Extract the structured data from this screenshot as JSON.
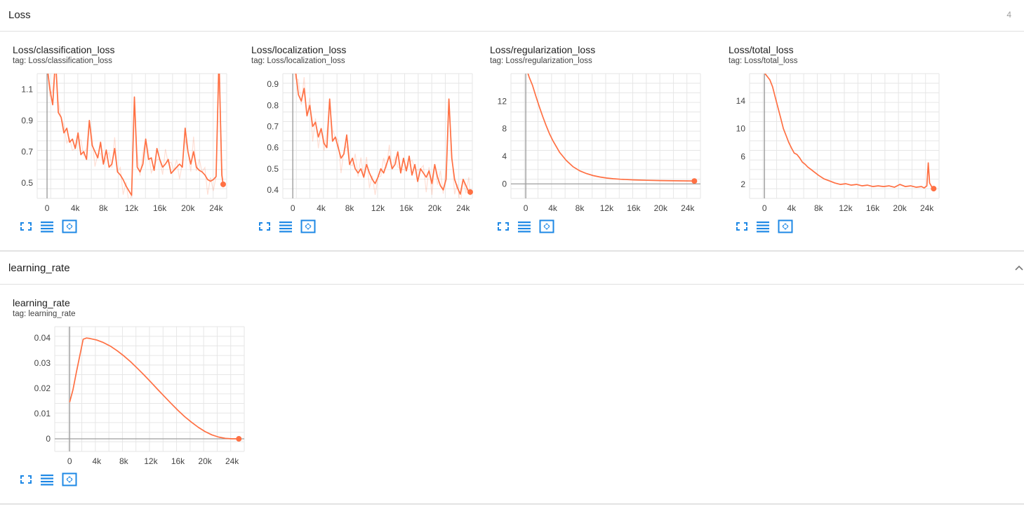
{
  "sections": [
    {
      "title": "Loss",
      "count": "4",
      "charts": [
        {
          "title": "Loss/classification_loss",
          "tag": "tag: Loss/classification_loss",
          "chart_data": {
            "type": "line",
            "x_ticks": [
              "0",
              "4k",
              "8k",
              "12k",
              "16k",
              "20k",
              "24k"
            ],
            "y_ticks": [
              "0.5",
              "0.7",
              "0.9",
              "1.1"
            ],
            "xlim": [
              -1400,
              25500
            ],
            "ylim": [
              0.4,
              1.2
            ],
            "series": [
              {
                "x": [
                  0,
                  400,
                  800,
                  1200,
                  1600,
                  2000,
                  2400,
                  2800,
                  3200,
                  3600,
                  4000,
                  4400,
                  4800,
                  5200,
                  5600,
                  6000,
                  6400,
                  6800,
                  7200,
                  7600,
                  8000,
                  8400,
                  8800,
                  9200,
                  9600,
                  10000,
                  10400,
                  10800,
                  11200,
                  11600,
                  12000,
                  12400,
                  12800,
                  13200,
                  13600,
                  14000,
                  14400,
                  14800,
                  15200,
                  15600,
                  16000,
                  16400,
                  16800,
                  17200,
                  17600,
                  18000,
                  18400,
                  18800,
                  19200,
                  19600,
                  20000,
                  20400,
                  20800,
                  21200,
                  21600,
                  22000,
                  22400,
                  22800,
                  23200,
                  23600,
                  24000,
                  24400,
                  24800,
                  25000
                ],
                "y": [
                  1.25,
                  1.1,
                  1.0,
                  1.3,
                  0.95,
                  0.92,
                  0.82,
                  0.85,
                  0.76,
                  0.78,
                  0.72,
                  0.82,
                  0.68,
                  0.7,
                  0.65,
                  0.9,
                  0.74,
                  0.7,
                  0.66,
                  0.76,
                  0.62,
                  0.71,
                  0.6,
                  0.62,
                  0.72,
                  0.57,
                  0.55,
                  0.52,
                  0.48,
                  0.45,
                  0.42,
                  1.05,
                  0.6,
                  0.57,
                  0.62,
                  0.78,
                  0.65,
                  0.66,
                  0.58,
                  0.72,
                  0.65,
                  0.6,
                  0.62,
                  0.65,
                  0.56,
                  0.58,
                  0.6,
                  0.62,
                  0.6,
                  0.85,
                  0.7,
                  0.62,
                  0.7,
                  0.6,
                  0.58,
                  0.57,
                  0.55,
                  0.52,
                  0.51,
                  0.52,
                  0.54,
                  1.3,
                  0.55,
                  0.49
                ]
              }
            ]
          }
        },
        {
          "title": "Loss/localization_loss",
          "tag": "tag: Loss/localization_loss",
          "chart_data": {
            "type": "line",
            "x_ticks": [
              "0",
              "4k",
              "8k",
              "12k",
              "16k",
              "20k",
              "24k"
            ],
            "y_ticks": [
              "0.4",
              "0.5",
              "0.6",
              "0.7",
              "0.8",
              "0.9"
            ],
            "xlim": [
              -1400,
              25300
            ],
            "ylim": [
              0.36,
              0.95
            ],
            "series": [
              {
                "x": [
                  0,
                  400,
                  800,
                  1200,
                  1600,
                  2000,
                  2400,
                  2800,
                  3200,
                  3600,
                  4000,
                  4400,
                  4800,
                  5200,
                  5600,
                  6000,
                  6400,
                  6800,
                  7200,
                  7600,
                  8000,
                  8400,
                  8800,
                  9200,
                  9600,
                  10000,
                  10400,
                  10800,
                  11200,
                  11600,
                  12000,
                  12400,
                  12800,
                  13200,
                  13600,
                  14000,
                  14400,
                  14800,
                  15200,
                  15600,
                  16000,
                  16400,
                  16800,
                  17200,
                  17600,
                  18000,
                  18400,
                  18800,
                  19200,
                  19600,
                  20000,
                  20400,
                  20800,
                  21200,
                  21600,
                  22000,
                  22400,
                  22800,
                  23200,
                  23600,
                  24000,
                  24400,
                  24800,
                  25000
                ],
                "y": [
                  1.0,
                  0.96,
                  0.85,
                  0.82,
                  0.88,
                  0.75,
                  0.8,
                  0.7,
                  0.72,
                  0.65,
                  0.69,
                  0.62,
                  0.6,
                  0.83,
                  0.63,
                  0.65,
                  0.6,
                  0.55,
                  0.57,
                  0.66,
                  0.52,
                  0.55,
                  0.5,
                  0.48,
                  0.5,
                  0.46,
                  0.52,
                  0.48,
                  0.45,
                  0.43,
                  0.46,
                  0.5,
                  0.48,
                  0.52,
                  0.56,
                  0.5,
                  0.52,
                  0.58,
                  0.48,
                  0.55,
                  0.49,
                  0.56,
                  0.47,
                  0.52,
                  0.44,
                  0.5,
                  0.48,
                  0.46,
                  0.49,
                  0.43,
                  0.52,
                  0.46,
                  0.42,
                  0.4,
                  0.45,
                  0.83,
                  0.55,
                  0.45,
                  0.41,
                  0.38,
                  0.45,
                  0.42,
                  0.39,
                  0.39
                ]
              }
            ]
          }
        },
        {
          "title": "Loss/regularization_loss",
          "tag": "tag: Loss/regularization_loss",
          "chart_data": {
            "type": "line",
            "x_ticks": [
              "0",
              "4k",
              "8k",
              "12k",
              "16k",
              "20k",
              "24k"
            ],
            "y_ticks": [
              "0",
              "4",
              "8",
              "12"
            ],
            "xlim": [
              -2200,
              25900
            ],
            "ylim": [
              -2.1,
              16
            ],
            "series": [
              {
                "x": [
                  0,
                  500,
                  1000,
                  1500,
                  2000,
                  2500,
                  3000,
                  3500,
                  4000,
                  5000,
                  6000,
                  7000,
                  8000,
                  9000,
                  10000,
                  11000,
                  12000,
                  13000,
                  14000,
                  16000,
                  18000,
                  20000,
                  22000,
                  24000,
                  25000
                ],
                "y": [
                  17,
                  15.5,
                  14.3,
                  12.7,
                  11.2,
                  9.8,
                  8.5,
                  7.3,
                  6.3,
                  4.6,
                  3.4,
                  2.5,
                  1.9,
                  1.5,
                  1.2,
                  1.0,
                  0.85,
                  0.75,
                  0.68,
                  0.58,
                  0.52,
                  0.48,
                  0.45,
                  0.43,
                  0.42
                ]
              }
            ]
          }
        },
        {
          "title": "Loss/total_loss",
          "tag": "tag: Loss/total_loss",
          "chart_data": {
            "type": "line",
            "x_ticks": [
              "0",
              "4k",
              "8k",
              "12k",
              "16k",
              "20k",
              "24k"
            ],
            "y_ticks": [
              "2",
              "6",
              "10",
              "14"
            ],
            "xlim": [
              -2200,
              25800
            ],
            "ylim": [
              0,
              17.9
            ],
            "series": [
              {
                "x": [
                  0,
                  400,
                  800,
                  1200,
                  1600,
                  2000,
                  2400,
                  2800,
                  3200,
                  3600,
                  4000,
                  4400,
                  4800,
                  5200,
                  5600,
                  6000,
                  6400,
                  6800,
                  7200,
                  7600,
                  8000,
                  8800,
                  9600,
                  10400,
                  11200,
                  12000,
                  12800,
                  13600,
                  14400,
                  15200,
                  16000,
                  16800,
                  17600,
                  18400,
                  19200,
                  20000,
                  20800,
                  21600,
                  22400,
                  23200,
                  23600,
                  24000,
                  24200,
                  24400,
                  24800,
                  25000
                ],
                "y": [
                  18,
                  17.5,
                  17,
                  16,
                  14.5,
                  13,
                  11.5,
                  10,
                  9,
                  8,
                  7.2,
                  6.5,
                  6.3,
                  5.8,
                  5.2,
                  4.9,
                  4.5,
                  4.2,
                  3.9,
                  3.6,
                  3.3,
                  2.8,
                  2.5,
                  2.2,
                  2.0,
                  2.1,
                  1.9,
                  2.0,
                  1.8,
                  1.9,
                  1.7,
                  1.8,
                  1.7,
                  1.8,
                  1.6,
                  2.0,
                  1.7,
                  1.8,
                  1.6,
                  1.7,
                  1.5,
                  1.8,
                  5.1,
                  2.2,
                  1.5,
                  1.4
                ]
              }
            ]
          }
        }
      ]
    },
    {
      "title": "learning_rate",
      "charts": [
        {
          "title": "learning_rate",
          "tag": "tag: learning_rate",
          "chart_data": {
            "type": "line",
            "x_ticks": [
              "0",
              "4k",
              "8k",
              "12k",
              "16k",
              "20k",
              "24k"
            ],
            "y_ticks": [
              "0",
              "0.01",
              "0.02",
              "0.03",
              "0.04"
            ],
            "xlim": [
              -2200,
              25800
            ],
            "ylim": [
              -0.005,
              0.0445
            ],
            "series": [
              {
                "x": [
                  0,
                  500,
                  1000,
                  1500,
                  2000,
                  2500,
                  3000,
                  4000,
                  5000,
                  6000,
                  7000,
                  8000,
                  9000,
                  10000,
                  11000,
                  12000,
                  13000,
                  14000,
                  15000,
                  16000,
                  17000,
                  18000,
                  19000,
                  20000,
                  21000,
                  22000,
                  23000,
                  24000,
                  25000
                ],
                "y": [
                  0.0145,
                  0.0195,
                  0.0265,
                  0.033,
                  0.0395,
                  0.04,
                  0.0398,
                  0.0392,
                  0.0382,
                  0.0368,
                  0.035,
                  0.0329,
                  0.0306,
                  0.028,
                  0.0253,
                  0.0225,
                  0.0196,
                  0.0168,
                  0.014,
                  0.0113,
                  0.0088,
                  0.0066,
                  0.0046,
                  0.0029,
                  0.0016,
                  0.0007,
                  0.0002,
                  0.0,
                  0.0
                ]
              }
            ]
          }
        }
      ]
    }
  ]
}
